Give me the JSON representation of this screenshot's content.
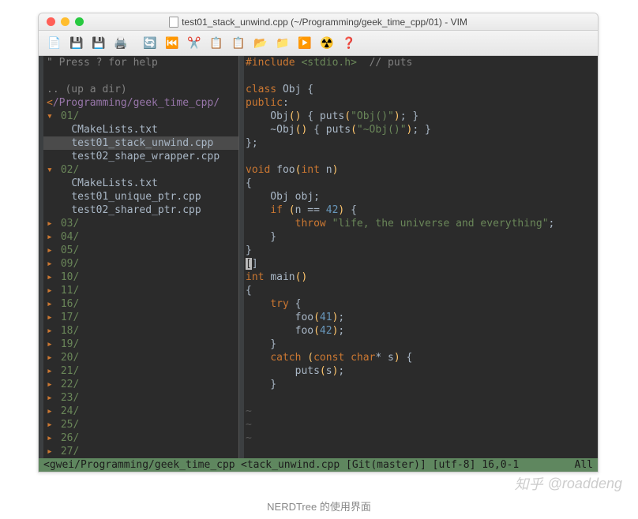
{
  "window": {
    "title": "test01_stack_unwind.cpp (~/Programming/geek_time_cpp/01) - VIM"
  },
  "toolbar_icons": [
    "new",
    "save",
    "saveall",
    "print",
    "refresh",
    "back",
    "cut",
    "copy",
    "paste",
    "open",
    "folder",
    "run",
    "hazard",
    "help"
  ],
  "nerdtree": {
    "help": "\" Press ? for help",
    "updir": ".. (up a dir)",
    "root_prefix": "<",
    "root_path": "/Programming/geek_time_cpp/",
    "items": [
      {
        "type": "dir",
        "name": "01/",
        "open": true,
        "children": [
          {
            "type": "file",
            "name": "CMakeLists.txt"
          },
          {
            "type": "file",
            "name": "test01_stack_unwind.cpp",
            "selected": true
          },
          {
            "type": "file",
            "name": "test02_shape_wrapper.cpp"
          }
        ]
      },
      {
        "type": "dir",
        "name": "02/",
        "open": true,
        "children": [
          {
            "type": "file",
            "name": "CMakeLists.txt"
          },
          {
            "type": "file",
            "name": "test01_unique_ptr.cpp"
          },
          {
            "type": "file",
            "name": "test02_shared_ptr.cpp"
          }
        ]
      },
      {
        "type": "dir",
        "name": "03/",
        "open": false
      },
      {
        "type": "dir",
        "name": "04/",
        "open": false
      },
      {
        "type": "dir",
        "name": "05/",
        "open": false
      },
      {
        "type": "dir",
        "name": "09/",
        "open": false
      },
      {
        "type": "dir",
        "name": "10/",
        "open": false
      },
      {
        "type": "dir",
        "name": "11/",
        "open": false
      },
      {
        "type": "dir",
        "name": "16/",
        "open": false
      },
      {
        "type": "dir",
        "name": "17/",
        "open": false
      },
      {
        "type": "dir",
        "name": "18/",
        "open": false
      },
      {
        "type": "dir",
        "name": "19/",
        "open": false
      },
      {
        "type": "dir",
        "name": "20/",
        "open": false
      },
      {
        "type": "dir",
        "name": "21/",
        "open": false
      },
      {
        "type": "dir",
        "name": "22/",
        "open": false
      },
      {
        "type": "dir",
        "name": "23/",
        "open": false
      },
      {
        "type": "dir",
        "name": "24/",
        "open": false
      },
      {
        "type": "dir",
        "name": "25/",
        "open": false
      },
      {
        "type": "dir",
        "name": "26/",
        "open": false
      },
      {
        "type": "dir",
        "name": "27/",
        "open": false
      }
    ]
  },
  "code": {
    "lang": "cpp",
    "lines": [
      {
        "t": [
          [
            "kw",
            "#include "
          ],
          [
            "inc",
            "<stdio.h>"
          ],
          [
            "op",
            "  "
          ],
          [
            "cmt",
            "// puts"
          ]
        ]
      },
      {
        "t": []
      },
      {
        "t": [
          [
            "ty",
            "class"
          ],
          [
            "op",
            " "
          ],
          [
            "cls",
            "Obj {"
          ]
        ]
      },
      {
        "t": [
          [
            "pub",
            "public"
          ],
          [
            "op",
            ":"
          ]
        ]
      },
      {
        "t": [
          [
            "op",
            "    Obj"
          ],
          [
            "yel",
            "()"
          ],
          [
            "op",
            " { puts"
          ],
          [
            "yel",
            "("
          ],
          [
            "str",
            "\"Obj()\""
          ],
          [
            "yel",
            ")"
          ],
          [
            "op",
            "; }"
          ]
        ]
      },
      {
        "t": [
          [
            "op",
            "    ~Obj"
          ],
          [
            "yel",
            "()"
          ],
          [
            "op",
            " { puts"
          ],
          [
            "yel",
            "("
          ],
          [
            "str",
            "\"~Obj()\""
          ],
          [
            "yel",
            ")"
          ],
          [
            "op",
            "; }"
          ]
        ]
      },
      {
        "t": [
          [
            "op",
            "};"
          ]
        ]
      },
      {
        "t": []
      },
      {
        "t": [
          [
            "ty",
            "void"
          ],
          [
            "op",
            " "
          ],
          [
            "fn",
            "foo"
          ],
          [
            "yel",
            "("
          ],
          [
            "ty",
            "int"
          ],
          [
            "op",
            " n"
          ],
          [
            "yel",
            ")"
          ]
        ]
      },
      {
        "t": [
          [
            "op",
            "{"
          ]
        ]
      },
      {
        "t": [
          [
            "op",
            "    Obj obj;"
          ]
        ]
      },
      {
        "t": [
          [
            "op",
            "    "
          ],
          [
            "kw",
            "if"
          ],
          [
            "op",
            " "
          ],
          [
            "yel",
            "("
          ],
          [
            "op",
            "n == "
          ],
          [
            "num",
            "42"
          ],
          [
            "yel",
            ")"
          ],
          [
            "op",
            " {"
          ]
        ]
      },
      {
        "t": [
          [
            "op",
            "        "
          ],
          [
            "kw",
            "throw"
          ],
          [
            "op",
            " "
          ],
          [
            "str",
            "\"life, the universe and everything\""
          ],
          [
            "op",
            ";"
          ]
        ]
      },
      {
        "t": [
          [
            "op",
            "    }"
          ]
        ]
      },
      {
        "t": [
          [
            "op",
            "}"
          ]
        ]
      },
      {
        "cursor": true,
        "t": [
          [
            "op",
            "[]"
          ]
        ]
      },
      {
        "t": [
          [
            "ty",
            "int "
          ],
          [
            "fn",
            "main"
          ],
          [
            "yel",
            "()"
          ]
        ]
      },
      {
        "t": [
          [
            "op",
            "{"
          ]
        ]
      },
      {
        "t": [
          [
            "op",
            "    "
          ],
          [
            "kw",
            "try"
          ],
          [
            "op",
            " {"
          ]
        ]
      },
      {
        "t": [
          [
            "op",
            "        foo"
          ],
          [
            "yel",
            "("
          ],
          [
            "num",
            "41"
          ],
          [
            "yel",
            ")"
          ],
          [
            "op",
            ";"
          ]
        ]
      },
      {
        "t": [
          [
            "op",
            "        foo"
          ],
          [
            "yel",
            "("
          ],
          [
            "num",
            "42"
          ],
          [
            "yel",
            ")"
          ],
          [
            "op",
            ";"
          ]
        ]
      },
      {
        "t": [
          [
            "op",
            "    }"
          ]
        ]
      },
      {
        "t": [
          [
            "op",
            "    "
          ],
          [
            "kw",
            "catch"
          ],
          [
            "op",
            " "
          ],
          [
            "yel",
            "("
          ],
          [
            "ty",
            "const char"
          ],
          [
            "op",
            "* s"
          ],
          [
            "yel",
            ")"
          ],
          [
            "op",
            " {"
          ]
        ]
      },
      {
        "t": [
          [
            "op",
            "        puts"
          ],
          [
            "yel",
            "("
          ],
          [
            "op",
            "s"
          ],
          [
            "yel",
            ")"
          ],
          [
            "op",
            ";"
          ]
        ]
      },
      {
        "t": [
          [
            "op",
            "    }"
          ]
        ]
      },
      {
        "t": []
      },
      {
        "tilde": true
      },
      {
        "tilde": true
      },
      {
        "tilde": true
      }
    ]
  },
  "status": {
    "left": "<gwei/Programming/geek_time_cpp",
    "right_a": "<tack_unwind.cpp [Git(master)]  [utf-8] 16,0-1",
    "right_b": "All"
  },
  "caption": "NERDTree 的使用界面",
  "watermark": "@roaddeng",
  "watermark_brand": "知乎"
}
